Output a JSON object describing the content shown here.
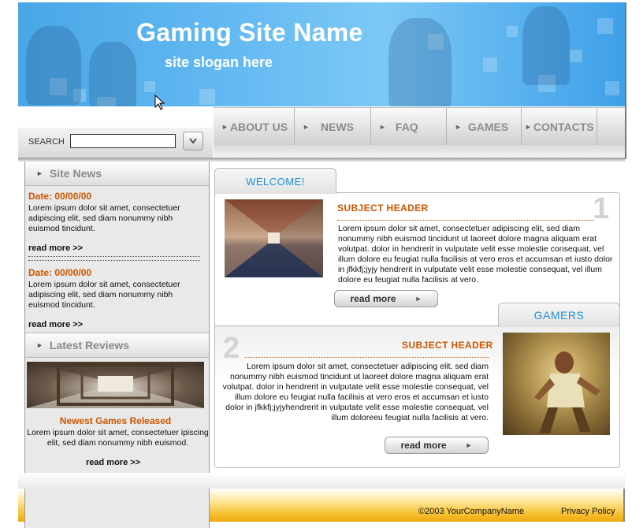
{
  "header": {
    "title": "Gaming Site Name",
    "slogan": "site slogan here"
  },
  "search": {
    "label": "SEARCH",
    "value": "",
    "go_icon": "chevron-down-icon"
  },
  "nav": {
    "items": [
      {
        "label": "ABOUT US"
      },
      {
        "label": "NEWS"
      },
      {
        "label": "FAQ"
      },
      {
        "label": "GAMES"
      },
      {
        "label": "CONTACTS"
      }
    ]
  },
  "sidebar": {
    "news_title": "Site News",
    "news": [
      {
        "date": "Date: 00/00/00",
        "text": "Lorem ipsum dolor sit amet, consectetuer adipiscing elit, sed diam nonummy nibh euismod tincidunt.",
        "read_more": "read more >>"
      },
      {
        "date": "Date: 00/00/00",
        "text": "Lorem ipsum dolor sit amet, consectetuer adipiscing elit, sed diam nonummy nibh euismod tincidunt.",
        "read_more": "read more >>"
      }
    ],
    "reviews_title": "Latest Reviews",
    "review": {
      "title": "Newest Games Released",
      "text": "Lorem ipsum dolor sit amet, consectetuer ipiscing elit, sed diam nonummy nibh euismod.",
      "read_more": "read more >>"
    }
  },
  "main": {
    "welcome_tab": "WELCOME!",
    "gamers_tab": "GAMERS",
    "article1": {
      "number": "1",
      "subject": "SUBJECT HEADER",
      "text": "Lorem ipsum dolor sit amet, consectetuer adipiscing elit, sed diam nonummy nibh euismod tincidunt ut laoreet dolore magna aliquam erat volutpat. dolor in hendrerit in vulputate velit esse molestie consequat, vel illum dolore eu feugiat nulla facilisis at vero eros et accumsan et iusto dolor in jfkkfj;jyjy hendrerit in vulputate velit esse molestie consequat, vel illum dolore eu feugiat nulla facilisis at vero.",
      "button": "read more"
    },
    "article2": {
      "number": "2",
      "subject": "SUBJECT HEADER",
      "text": "Lorem ipsum dolor sit amet, consectetuer adipiscing elit, sed diam nonummy nibh euismod tincidunt ut laoreet dolore magna aliquam erat volutpat. dolor in hendrerit in vulputate velit esse molestie consequat, vel illum dolore eu feugiat nulla facilisis at vero eros et accumsan et iusto dolor in jfkkfj;jyjyhendrerit in vulputate velit esse molestie consequat, vel illum doloreeu feugiat nulla facilisis at vero.",
      "button": "read more"
    }
  },
  "footer": {
    "copyright": "©2003 YourCompanyName",
    "privacy": "Privacy Policy"
  }
}
